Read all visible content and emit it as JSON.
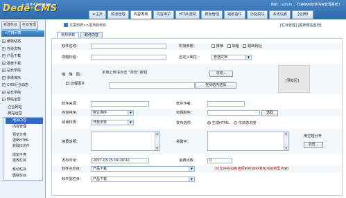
{
  "brand": {
    "logo": "Dede·CMS",
    "subtitle": "织梦内容管理系统"
  },
  "user_info": "你好：admin ，欢迎使用织梦内容管理系统！",
  "nav": [
    "★主页",
    "频道管理",
    "内容发布",
    "内容维护",
    "HTML更新",
    "模板管理",
    "辅助插件",
    "功能模块",
    "系统设置",
    "【全屏】"
  ],
  "sidebar": {
    "buttons": [
      "新建栏目",
      "栏目管理"
    ],
    "header": "☆栏目列表",
    "items": [
      "最新动态",
      "在线文档",
      "产品下载",
      "模板下载",
      "站长学院",
      "系统演示",
      "CMS行业动态",
      "站长学院",
      "网站运营",
      "·企业网站",
      "·网站运营",
      "·装修"
    ],
    "sub_items": [
      "增加内容",
      "内容管理",
      "预览分类",
      "更新HTML",
      "获取JS文件",
      "增加子类",
      "更改栏目",
      "移动栏目",
      "删除栏目"
    ]
  },
  "breadcrumb": "文章列表>>发布新软件",
  "top_links": "[栏目管理] [更新网站首页]",
  "tabs": [
    "常规参数",
    "软件内容"
  ],
  "form": {
    "software_name_label": "软件名称：",
    "extra_props_label": "附加参数：",
    "extra_checks": [
      "推荐",
      "加粗",
      "跳转网址"
    ],
    "short_title_label": "简略标题：",
    "custom_attr_label": "自定义属性：",
    "custom_attr_value": "普通文档",
    "thumb_label": "缩　略　图：",
    "local_upload_hint": "本地上传请点击 \"浏览\" 按钮",
    "browse_btn": "浏览...",
    "remote_pic_label": "远程图片",
    "site_select_btn": "在网站内选择",
    "preview_label": "[预览区]",
    "source_label": "软件来源：",
    "author_label": "软件作者：",
    "sort_label": "内容排序：",
    "sort_value": "默认排序",
    "title_color_label": "标题颜色：",
    "choose_btn": "选取",
    "read_perm_label": "阅读权限：",
    "read_perm_value": "开放浏览",
    "publish_opt_label": "发布选项：",
    "publish_html": "生成HTML",
    "publish_dynamic": "仅动态浏览",
    "summary_label": "简要说明：",
    "keywords_label": "关键字：",
    "keyword_hint1": "用空格分开",
    "browse_btn2": "浏览...",
    "publish_time_label": "发布时间：",
    "publish_time_value": "2007-03-25 04:26:42",
    "points_label": "消费点数：",
    "points_value": "0",
    "main_col_label": "软件主栏目：",
    "main_col_value": "产品下载",
    "main_col_notice": "（只允许在白色选项的栏目中发布当前类型内容）",
    "sub_col_label": "软件副栏目：",
    "sub_col_value": "产品下载"
  },
  "colors": {
    "nav_bg": "#2f6aa9",
    "accent": "#316ac5",
    "logo": "#ffd24a"
  }
}
